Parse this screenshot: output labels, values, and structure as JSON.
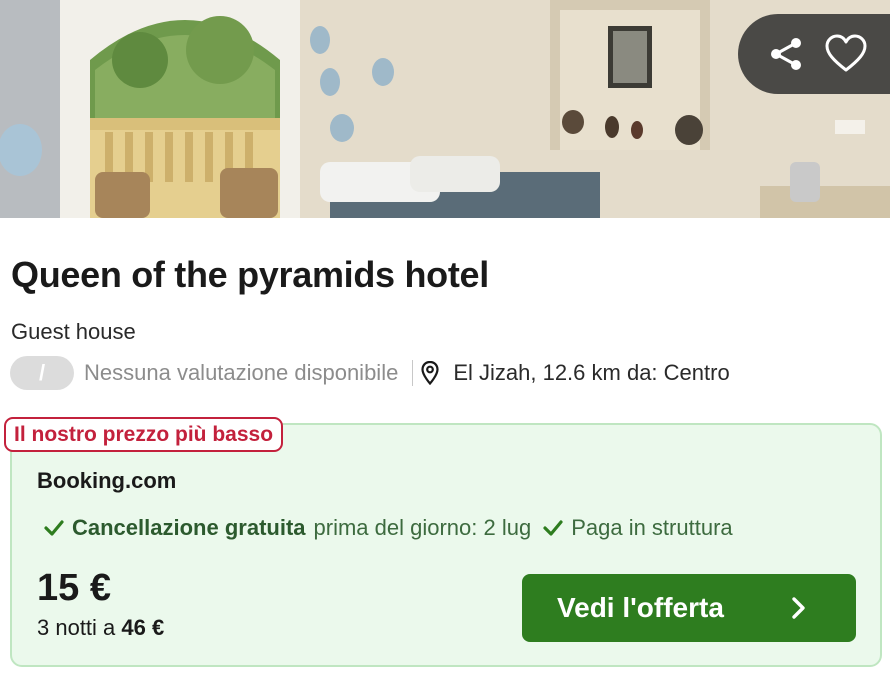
{
  "hotel": {
    "name": "Queen of the pyramids hotel",
    "type": "Guest house",
    "rating_value": "/",
    "rating_text": "Nessuna valutazione disponibile",
    "location": "El Jizah, 12.6 km da: Centro"
  },
  "photo_actions": {
    "share_icon": "share-icon",
    "favorite_icon": "heart-icon"
  },
  "offer": {
    "badge": "Il nostro prezzo più basso",
    "provider": "Booking.com",
    "free_cancel": "Cancellazione gratuita",
    "cancel_until": "prima del giorno: 2 lug",
    "pay_at_property": "Paga in struttura",
    "price": "15 €",
    "nights_prefix": "3 notti a",
    "total": "46 €",
    "cta_label": "Vedi l'offerta"
  },
  "colors": {
    "accent_green": "#2e7d1f",
    "offer_bg": "#ebf9ec",
    "badge_red": "#c3213c"
  }
}
